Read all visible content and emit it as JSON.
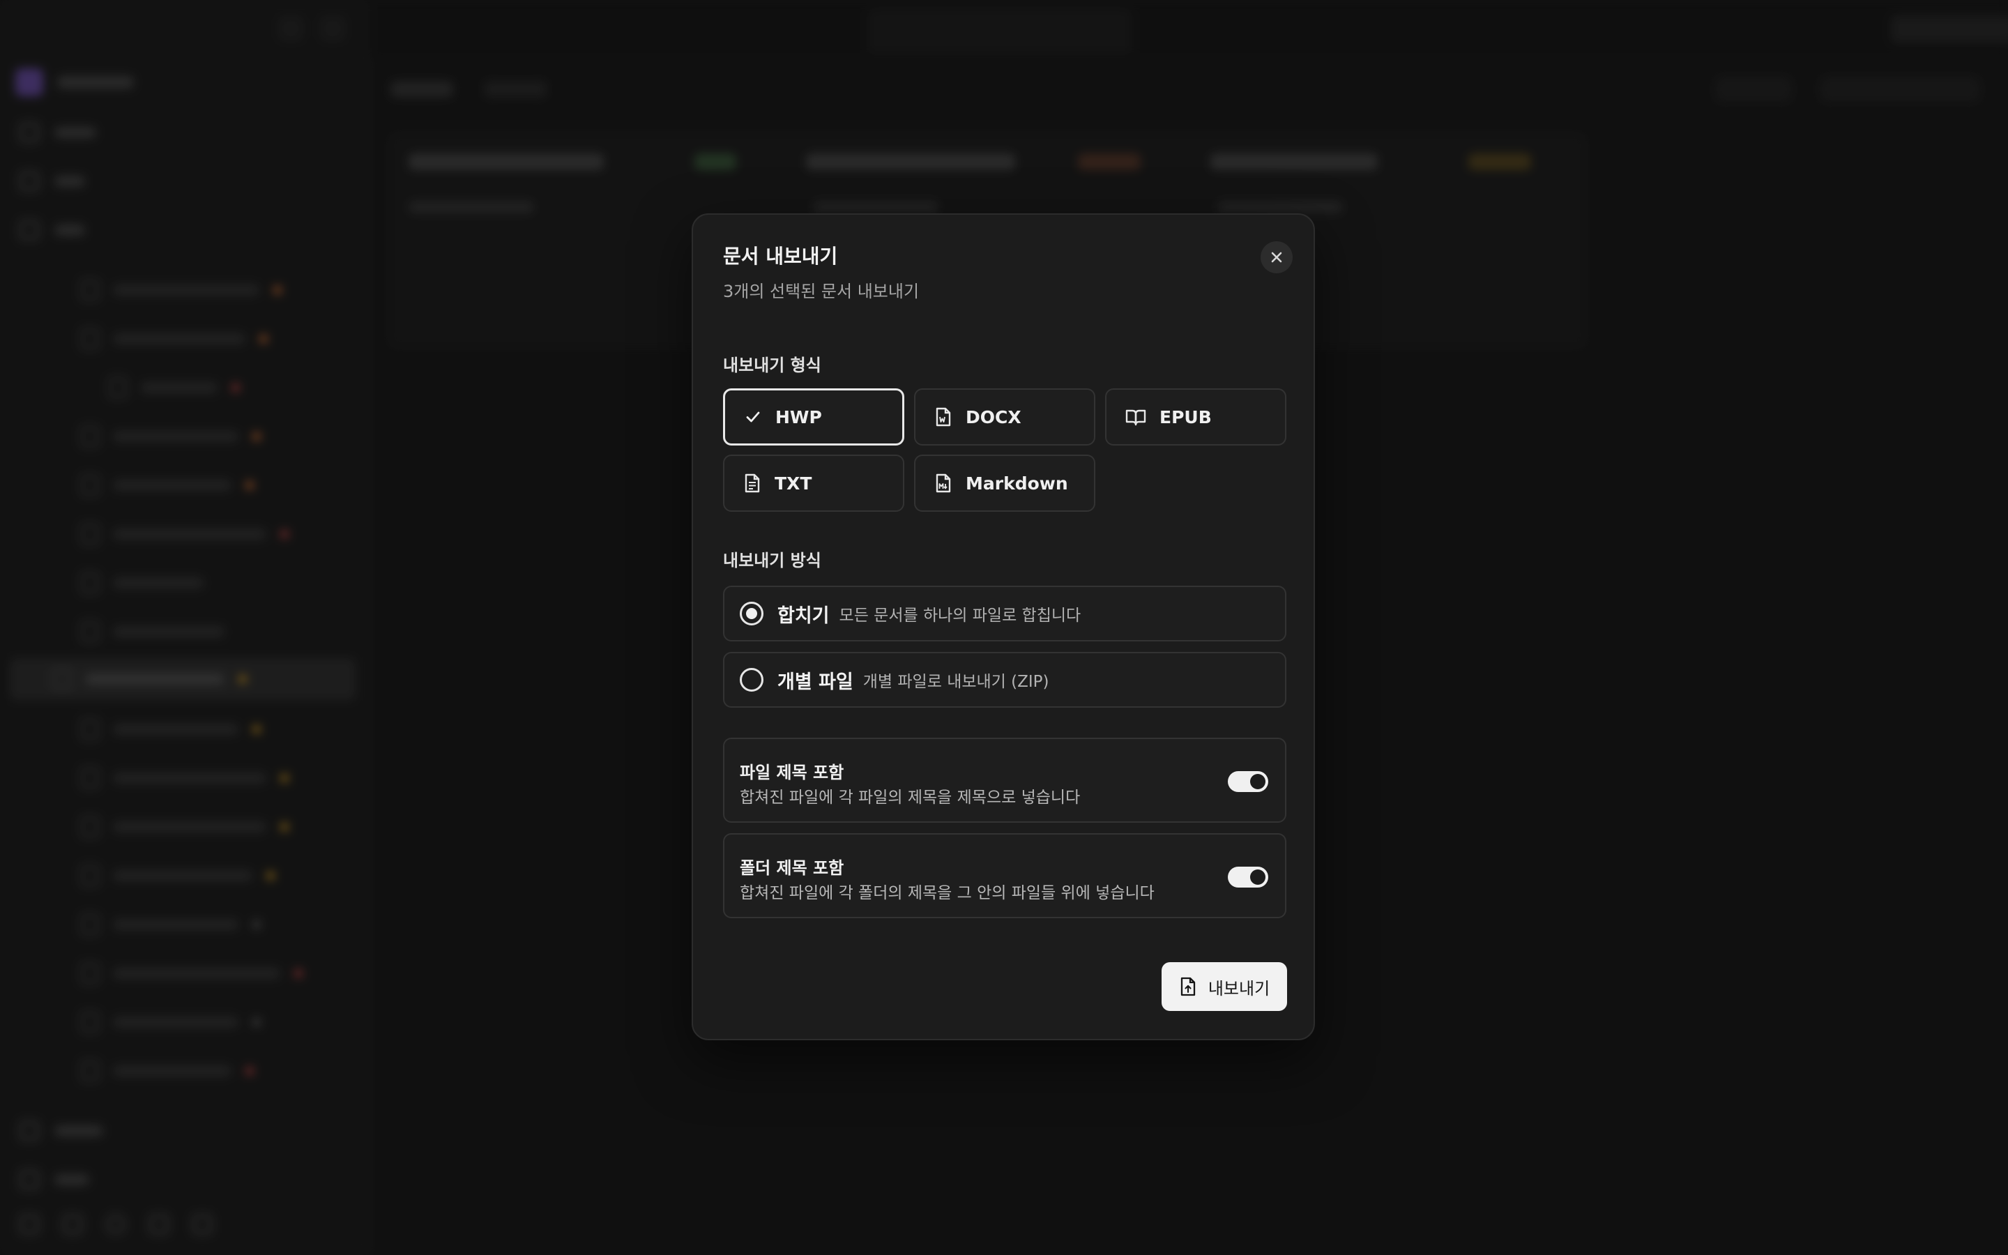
{
  "modal": {
    "title": "문서 내보내기",
    "subtitle": "3개의 선택된 문서 내보내기",
    "close_icon": "close-icon",
    "format_section_label": "내보내기 형식",
    "formats": [
      {
        "label": "HWP",
        "icon": "check-icon",
        "selected": true
      },
      {
        "label": "DOCX",
        "icon": "file-word-icon",
        "selected": false
      },
      {
        "label": "EPUB",
        "icon": "book-open-icon",
        "selected": false
      },
      {
        "label": "TXT",
        "icon": "file-text-icon",
        "selected": false
      },
      {
        "label": "Markdown",
        "icon": "file-markdown-icon",
        "selected": false
      }
    ],
    "method_section_label": "내보내기 방식",
    "methods": [
      {
        "name": "합치기",
        "description": "모든 문서를 하나의 파일로 합칩니다",
        "selected": true
      },
      {
        "name": "개별 파일",
        "description": "개별 파일로 내보내기 (ZIP)",
        "selected": false
      }
    ],
    "options": [
      {
        "name": "파일 제목 포함",
        "description": "합쳐진 파일에 각 파일의 제목을 제목으로 넣습니다",
        "enabled": true
      },
      {
        "name": "폴더 제목 포함",
        "description": "합쳐진 파일에 각 폴더의 제목을 그 안의 파일들 위에 넣습니다",
        "enabled": true
      }
    ],
    "export_button_label": "내보내기",
    "export_button_icon": "file-upload-icon"
  },
  "colors": {
    "modal_bg": "#1c1c1c",
    "border": "#333333",
    "selected_border": "#e8e8e8",
    "button_bg": "#f2f2f2",
    "accent_dots": [
      "#e0783a",
      "#d9a028",
      "#c94a4a"
    ]
  }
}
